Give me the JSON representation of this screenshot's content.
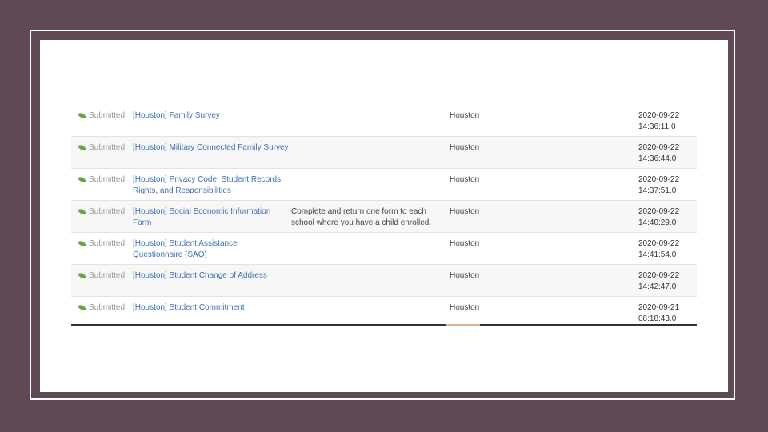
{
  "rows": [
    {
      "status": "Submitted",
      "title": "[Houston] Family Survey",
      "note": "",
      "city": "Houston",
      "date": "2020-09-22",
      "time": "14:36:11.0"
    },
    {
      "status": "Submitted",
      "title": "[Houston] Military Connected Family Survey",
      "note": "",
      "city": "Houston",
      "date": "2020-09-22",
      "time": "14:36:44.0"
    },
    {
      "status": "Submitted",
      "title": "[Houston] Privacy Code: Student Records, Rights, and Responsibilities",
      "note": "",
      "city": "Houston",
      "date": "2020-09-22",
      "time": "14:37:51.0"
    },
    {
      "status": "Submitted",
      "title": "[Houston] Social Economic Information Form",
      "note": "Complete and return one form to each school where you have a child enrolled.",
      "city": "Houston",
      "date": "2020-09-22",
      "time": "14:40:29.0"
    },
    {
      "status": "Submitted",
      "title": "[Houston] Student Assistance Questionnaire (SAQ)",
      "note": "",
      "city": "Houston",
      "date": "2020-09-22",
      "time": "14:41:54.0"
    },
    {
      "status": "Submitted",
      "title": "[Houston] Student Change of Address",
      "note": "",
      "city": "Houston",
      "date": "2020-09-22",
      "time": "14:42:47.0"
    },
    {
      "status": "Submitted",
      "title": "[Houston] Student Commitment",
      "note": "",
      "city": "Houston",
      "date": "2020-09-21",
      "time": "08:18:43.0"
    }
  ],
  "colors": {
    "link": "#3d72b4",
    "status_icon": "#5cab3c",
    "frame_bg": "#5e4a55"
  },
  "icons": {
    "status": "leaf-icon"
  }
}
